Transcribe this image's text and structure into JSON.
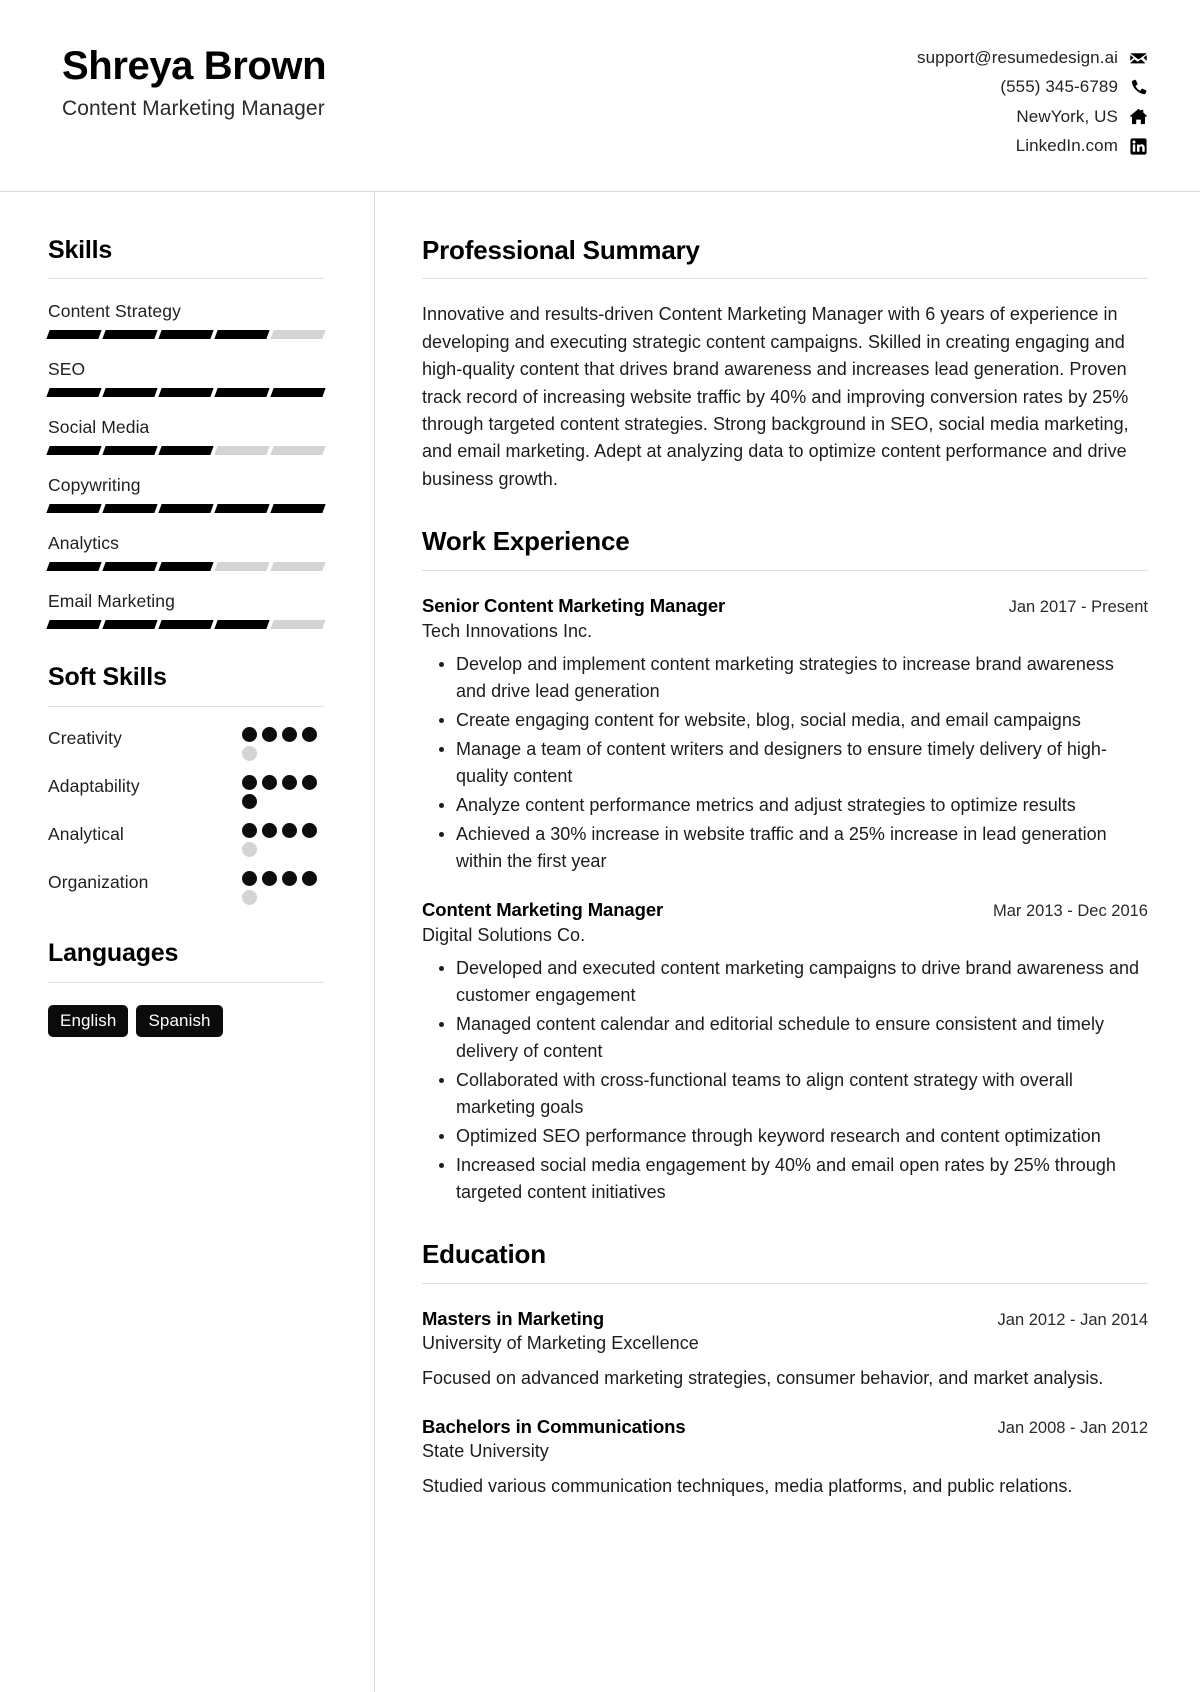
{
  "header": {
    "name": "Shreya Brown",
    "role": "Content Marketing Manager",
    "contacts": [
      {
        "text": "support@resumedesign.ai",
        "icon": "envelope-icon"
      },
      {
        "text": "(555) 345-6789",
        "icon": "phone-icon"
      },
      {
        "text": "NewYork, US",
        "icon": "home-icon"
      },
      {
        "text": "LinkedIn.com",
        "icon": "linkedin-icon"
      }
    ]
  },
  "sidebar": {
    "skills": {
      "title": "Skills",
      "max": 5,
      "items": [
        {
          "label": "Content Strategy",
          "level": 4
        },
        {
          "label": "SEO",
          "level": 5
        },
        {
          "label": "Social Media",
          "level": 3
        },
        {
          "label": "Copywriting",
          "level": 5
        },
        {
          "label": "Analytics",
          "level": 3
        },
        {
          "label": "Email Marketing",
          "level": 4
        }
      ]
    },
    "soft_skills": {
      "title": "Soft Skills",
      "max": 5,
      "items": [
        {
          "label": "Creativity",
          "level": 4
        },
        {
          "label": "Adaptability",
          "level": 5
        },
        {
          "label": "Analytical",
          "level": 4
        },
        {
          "label": "Organization",
          "level": 4
        }
      ]
    },
    "languages": {
      "title": "Languages",
      "items": [
        "English",
        "Spanish"
      ]
    }
  },
  "main": {
    "summary": {
      "title": "Professional Summary",
      "text": "Innovative and results-driven Content Marketing Manager with 6 years of experience in developing and executing strategic content campaigns. Skilled in creating engaging and high-quality content that drives brand awareness and increases lead generation. Proven track record of increasing website traffic by 40% and improving conversion rates by 25% through targeted content strategies. Strong background in SEO, social media marketing, and email marketing. Adept at analyzing data to optimize content performance and drive business growth."
    },
    "work": {
      "title": "Work Experience",
      "jobs": [
        {
          "title": "Senior Content Marketing Manager",
          "date": "Jan 2017 - Present",
          "org": "Tech Innovations Inc.",
          "bullets": [
            "Develop and implement content marketing strategies to increase brand awareness and drive lead generation",
            "Create engaging content for website, blog, social media, and email campaigns",
            "Manage a team of content writers and designers to ensure timely delivery of high-quality content",
            "Analyze content performance metrics and adjust strategies to optimize results",
            "Achieved a 30% increase in website traffic and a 25% increase in lead generation within the first year"
          ]
        },
        {
          "title": "Content Marketing Manager",
          "date": "Mar 2013 - Dec 2016",
          "org": "Digital Solutions Co.",
          "bullets": [
            "Developed and executed content marketing campaigns to drive brand awareness and customer engagement",
            "Managed content calendar and editorial schedule to ensure consistent and timely delivery of content",
            "Collaborated with cross-functional teams to align content strategy with overall marketing goals",
            "Optimized SEO performance through keyword research and content optimization",
            "Increased social media engagement by 40% and email open rates by 25% through targeted content initiatives"
          ]
        }
      ]
    },
    "education": {
      "title": "Education",
      "entries": [
        {
          "title": "Masters in Marketing",
          "date": "Jan 2012 - Jan 2014",
          "org": "University of Marketing Excellence",
          "desc": "Focused on advanced marketing strategies, consumer behavior, and market analysis."
        },
        {
          "title": "Bachelors in Communications",
          "date": "Jan 2008 - Jan 2012",
          "org": "State University",
          "desc": "Studied various communication techniques, media platforms, and public relations."
        }
      ]
    }
  },
  "colors": {
    "accent": "#000000",
    "muted_bar": "#d4d4d4",
    "rule": "#d9d9d9",
    "text": "#1c1c1c"
  }
}
